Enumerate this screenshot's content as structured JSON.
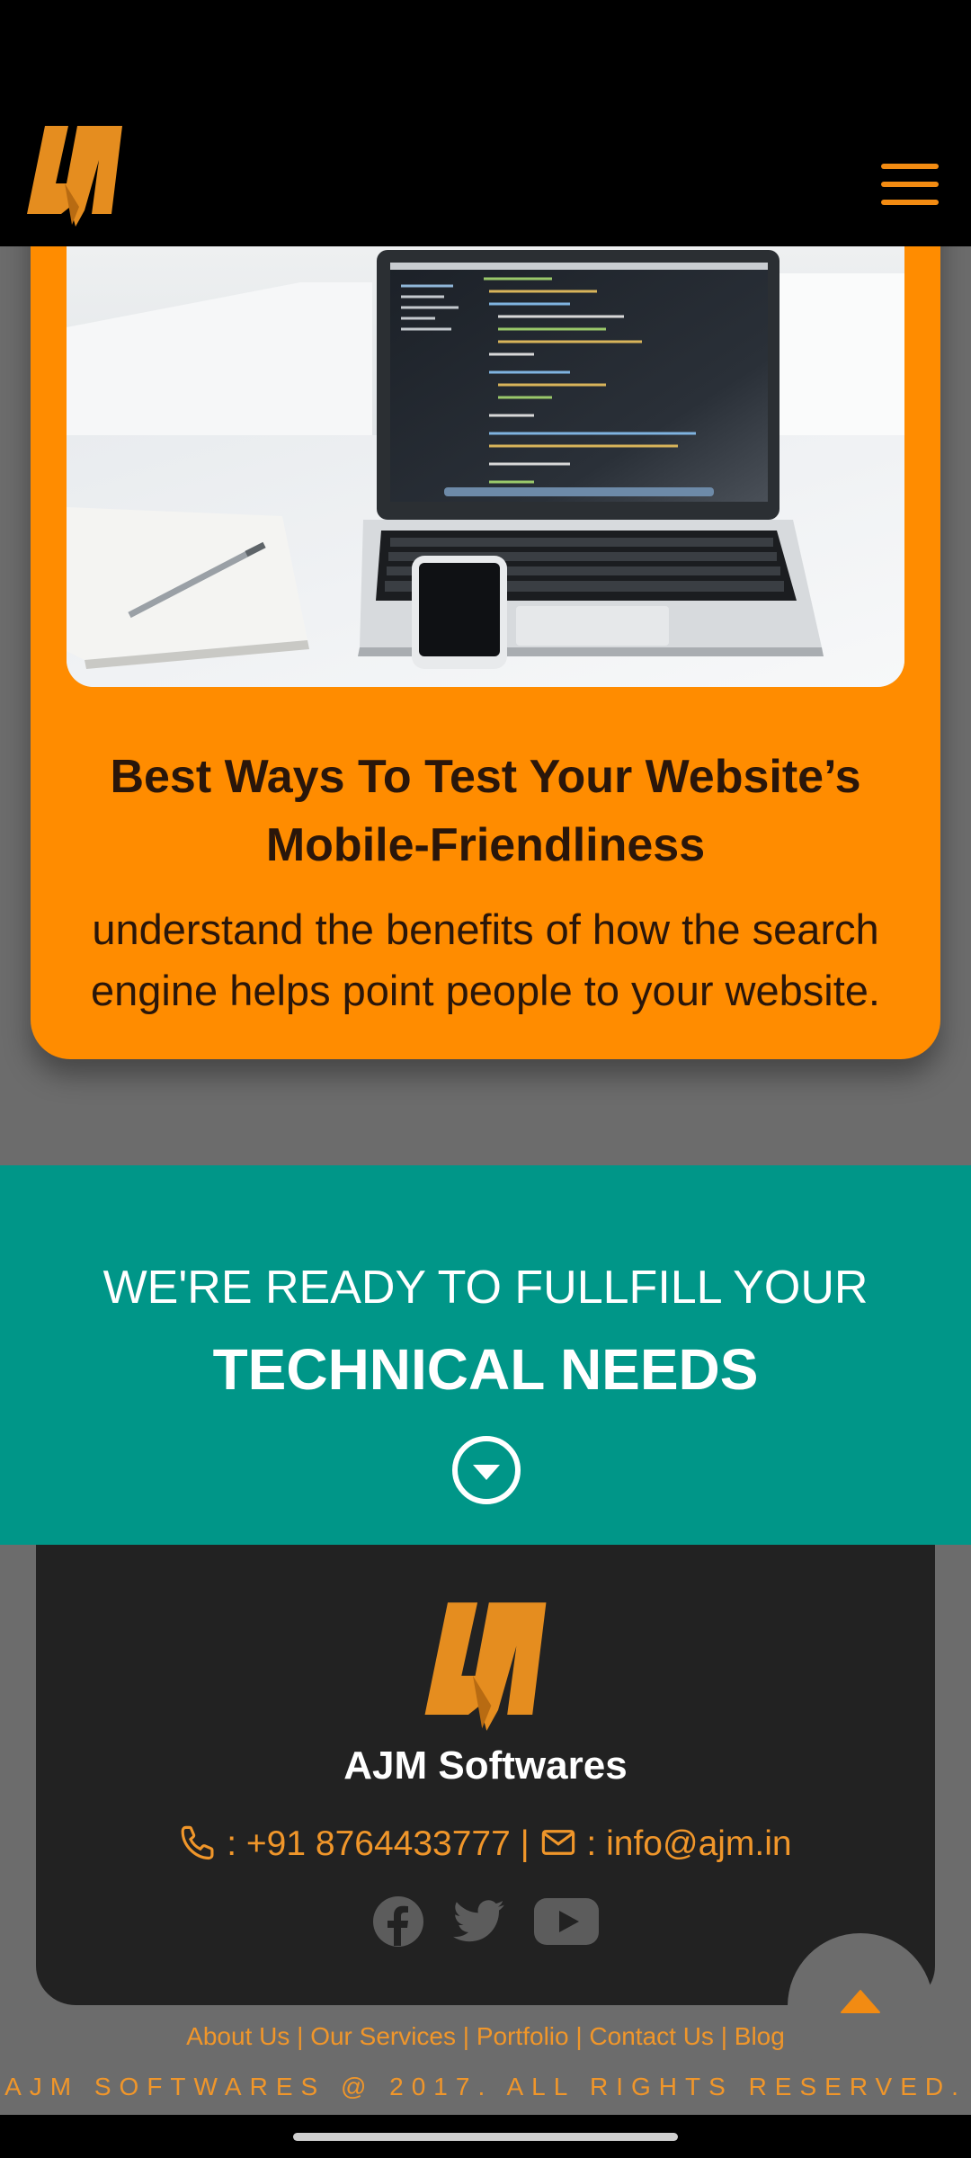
{
  "header": {
    "logo_icon": "ajm-logo",
    "menu_icon": "hamburger-menu-icon",
    "accent_color": "#f28b12"
  },
  "blog_card": {
    "image_subject": "laptop-with-code-notebook-phone",
    "title": "Best Ways To Test Your Website’s Mobile-Friendliness",
    "description": "understand the benefits of how the search engine helps point people to your website.",
    "background_color": "#ff8c00"
  },
  "banner": {
    "line1": "WE'RE READY TO FULLFILL YOUR",
    "line2": "TECHNICAL NEEDS",
    "arrow_icon": "chevron-down-circle-icon",
    "background_color": "#009688"
  },
  "footer": {
    "brand": "AJM Softwares",
    "phone_prefix": " : ",
    "phone": "+91 8764433777",
    "separator": " | ",
    "email_prefix": " : ",
    "email": "info@ajm.in",
    "social_icons": [
      "facebook-icon",
      "twitter-icon",
      "youtube-icon"
    ],
    "links": [
      "About Us",
      "Our Services",
      "Portfolio",
      "Contact Us",
      "Blog"
    ],
    "link_separator": " | ",
    "copyright": "AJM SOFTWARES @ 2017. ALL RIGHTS RESERVED.",
    "scroll_top_icon": "caret-up-icon"
  }
}
